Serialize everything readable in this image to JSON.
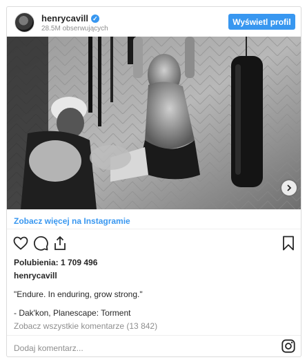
{
  "header": {
    "username": "henrycavill",
    "followers": "28.5M obserwujących",
    "view_profile_label": "Wyświetl profil"
  },
  "links": {
    "see_more": "Zobacz więcej na Instagramie"
  },
  "post": {
    "likes": "Polubienia: 1 709 496",
    "caption_username": "henrycavill",
    "caption_quote": "\"Endure. In enduring, grow strong.\"",
    "caption_source": "- Dak'kon, Planescape: Torment",
    "view_comments": "Zobacz wszystkie komentarze (13 842)"
  },
  "comment": {
    "placeholder": "Dodaj komentarz..."
  },
  "colors": {
    "accent": "#3897f0",
    "muted_text": "#8e8e8e",
    "border": "#dbdbdb"
  },
  "icons": {
    "like": "heart-icon",
    "comment": "comment-icon",
    "share": "share-icon",
    "save": "bookmark-icon",
    "brand": "instagram-icon",
    "verified": "verified-badge-icon",
    "next": "chevron-right-icon"
  }
}
